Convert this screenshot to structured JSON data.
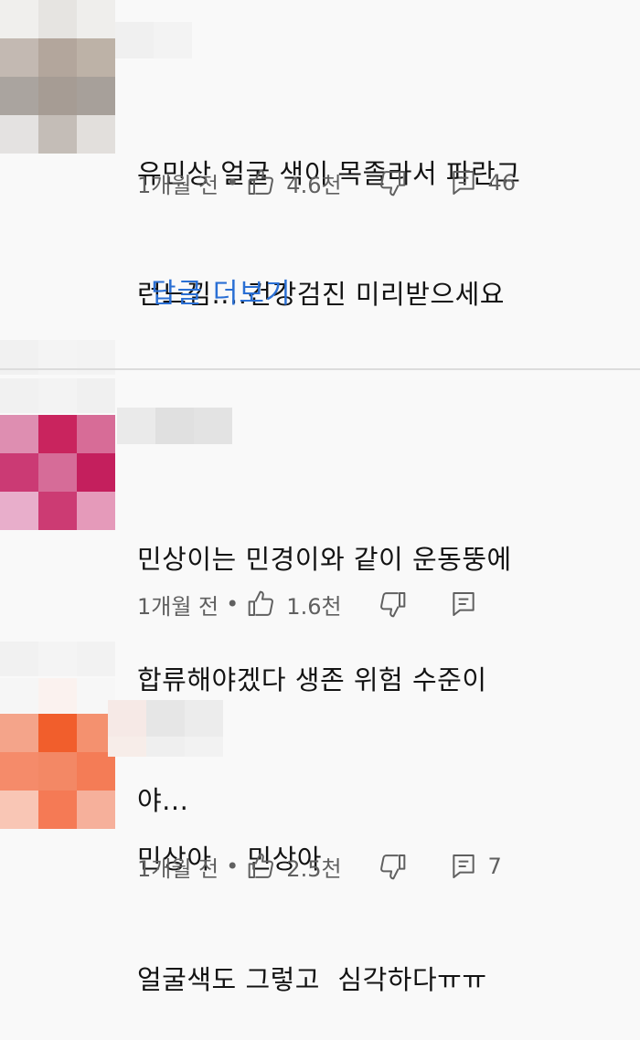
{
  "comments": [
    {
      "text_lines": [
        "유민상 얼굴 색이 목졸라서 파란그",
        "런느낌....건강검진 미리받으세요"
      ],
      "time": "1개월 전",
      "likes": "4.6천",
      "replies": "46",
      "more_replies_label": "답글 더보기",
      "avatar_colors": [
        "#c3b9b2",
        "#b3a69c",
        "#bdb2a7",
        "#aaa49f",
        "#a69c94",
        "#a7a09a",
        "#e4e2e1",
        "#c4bdb7",
        "#e2dfdc"
      ]
    },
    {
      "text_lines": [
        "민상이는 민경이와 같이 운동뚱에",
        "합류해야겠다 생존 위험 수준이",
        "야..."
      ],
      "time": "1개월 전",
      "likes": "1.6천",
      "replies": "",
      "avatar_colors": [
        "#de8eb1",
        "#c9245e",
        "#d76c97",
        "#cb3a74",
        "#d66c98",
        "#c41f5d",
        "#e8aecb",
        "#cc3b73",
        "#e59aba"
      ]
    },
    {
      "text_lines": [
        "민상아    민상아",
        "얼굴색도 그렇고  심각하다ㅠㅠ"
      ],
      "time": "1개월 전",
      "likes": "2.5천",
      "replies": "7",
      "avatar_colors": [
        "#f4a48a",
        "#f15e2c",
        "#f4916f",
        "#f58b6a",
        "#f38865",
        "#f47c56",
        "#f9c6b5",
        "#f57a55",
        "#f6b09b"
      ]
    }
  ],
  "icons": {
    "like": "thumbs-up-icon",
    "dislike": "thumbs-down-icon",
    "reply": "reply-icon"
  }
}
